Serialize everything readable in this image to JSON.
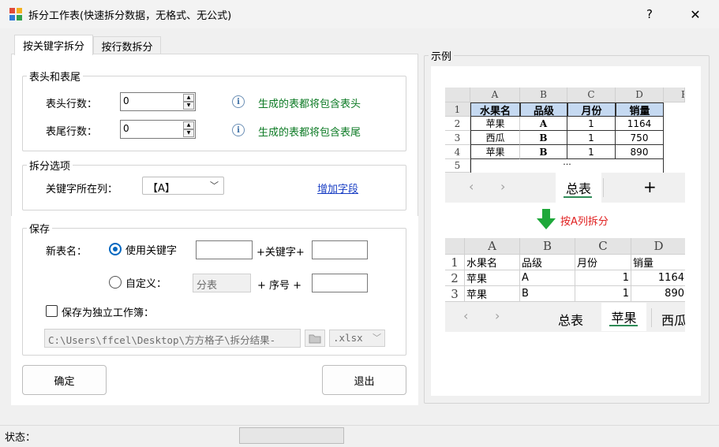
{
  "window": {
    "title": "拆分工作表(快速拆分数据，无格式、无公式)",
    "help_label": "?",
    "close_label": "✕"
  },
  "tabs": [
    {
      "label": "按关键字拆分",
      "active": true
    },
    {
      "label": "按行数拆分",
      "active": false
    }
  ],
  "header_footer": {
    "group_label": "表头和表尾",
    "header_rows_label": "表头行数：",
    "header_rows_value": "0",
    "header_hint": "生成的表都将包含表头",
    "footer_rows_label": "表尾行数：",
    "footer_rows_value": "0",
    "footer_hint": "生成的表都将包含表尾",
    "info_glyph": "i"
  },
  "split_options": {
    "group_label": "拆分选项",
    "key_column_label": "关键字所在列：",
    "key_column_value": "【A】",
    "add_field_link": "增加字段"
  },
  "save": {
    "group_label": "保存",
    "new_name_label": "新表名：",
    "use_keyword_label": "使用关键字",
    "use_keyword_checked": true,
    "plus_keyword_label": "+关键字+",
    "prefix_value": "",
    "suffix_value": "",
    "custom_label": "自定义：",
    "custom_checked": false,
    "custom_placeholder": "分表",
    "plus_seq_label": "+ 序号 +",
    "custom_suffix_value": "",
    "save_workbook_label": "保存为独立工作簿：",
    "save_workbook_checked": false,
    "path_value": "C:\\Users\\ffcel\\Desktop\\方方格子\\拆分结果-",
    "ext_value": ".xlsx"
  },
  "buttons": {
    "ok_label": "确定",
    "exit_label": "退出"
  },
  "example": {
    "group_label": "示例",
    "top_sheet": {
      "col_headers": [
        "A",
        "B",
        "C",
        "D",
        "E"
      ],
      "row_headers": [
        "1",
        "2",
        "3",
        "4",
        "5"
      ],
      "header_row": [
        "水果名",
        "品级",
        "月份",
        "销量"
      ],
      "rows": [
        [
          "苹果",
          "A",
          "1",
          "1164"
        ],
        [
          "西瓜",
          "B",
          "1",
          "750"
        ],
        [
          "苹果",
          "B",
          "1",
          "890"
        ]
      ],
      "ellipsis": "...",
      "tabs": [
        "总表"
      ],
      "add_tab": "+"
    },
    "arrow_label": "按A列拆分",
    "bottom_sheet": {
      "col_headers": [
        "A",
        "B",
        "C",
        "D"
      ],
      "row_headers": [
        "1",
        "2",
        "3"
      ],
      "header_row": [
        "水果名",
        "品级",
        "月份",
        "销量"
      ],
      "rows": [
        [
          "苹果",
          "A",
          "1",
          "1164"
        ],
        [
          "苹果",
          "B",
          "1",
          "890"
        ]
      ],
      "tabs": [
        "总表",
        "苹果",
        "西瓜"
      ],
      "active_tab": "苹果"
    }
  },
  "status": {
    "label": "状态：",
    "progress": 0
  },
  "colors": {
    "hint_green": "#0c7a24",
    "link_blue": "#1a3fc4",
    "accent": "#0067c0",
    "arrow_red": "#e02020",
    "arrow_green": "#1ea83a",
    "header_blue": "#c5d9f1"
  }
}
